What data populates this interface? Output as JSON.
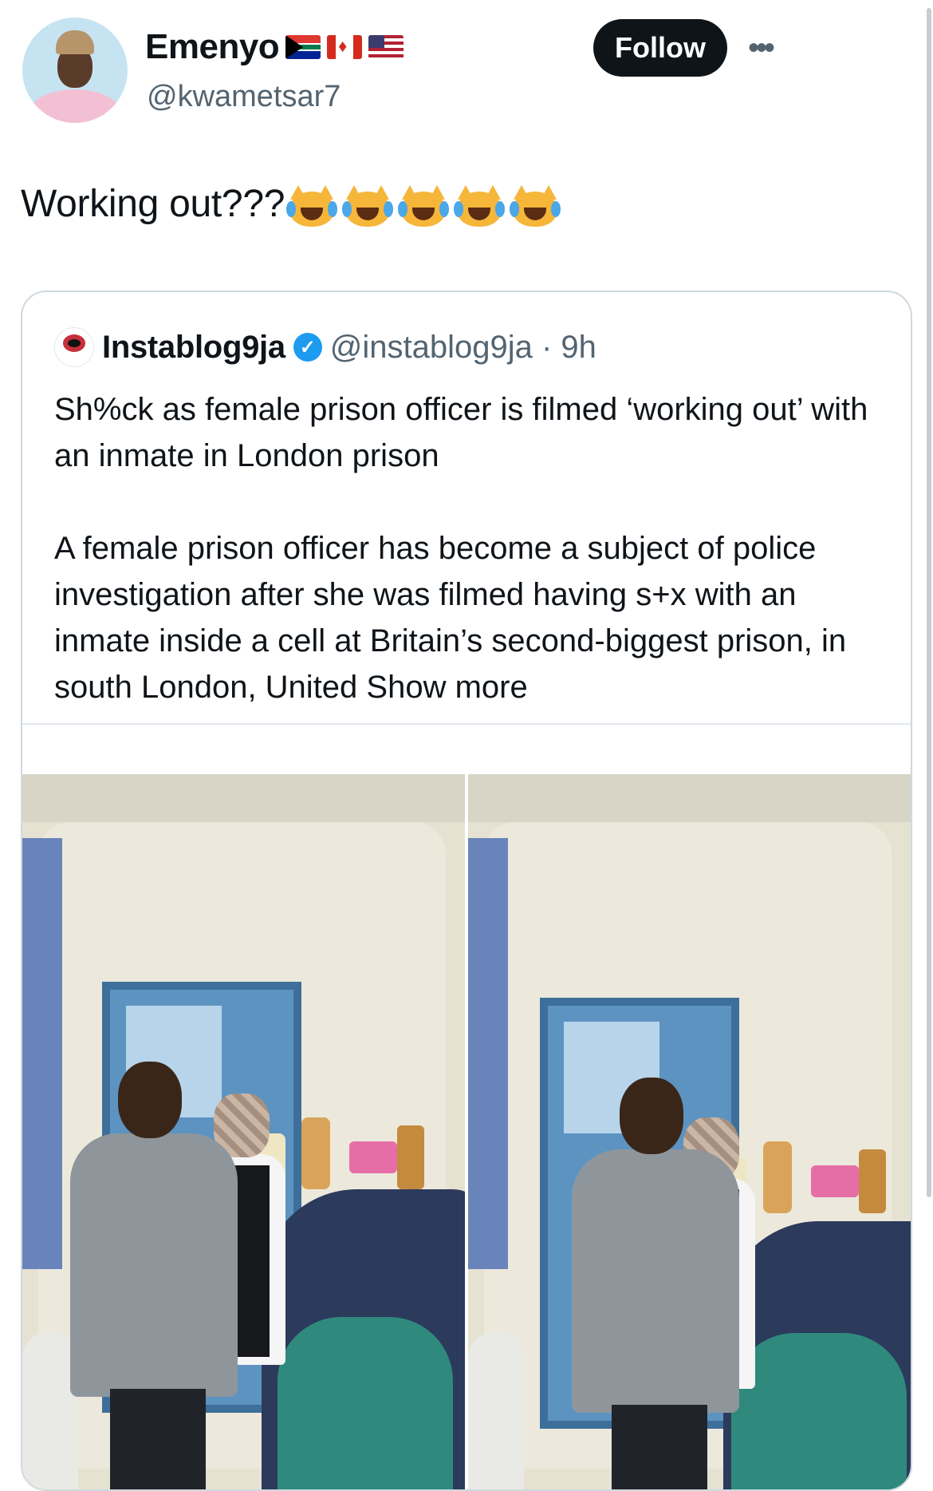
{
  "tweet": {
    "author_name": "Emenyo",
    "author_flags": [
      "flag-south-africa-icon",
      "flag-canada-icon",
      "flag-usa-icon"
    ],
    "author_handle": "@kwametsar7",
    "follow_label": "Follow",
    "more_label": "•••",
    "text": "Working out???",
    "emoji": [
      "cat-with-tears-of-joy",
      "cat-with-tears-of-joy",
      "cat-with-tears-of-joy",
      "cat-with-tears-of-joy",
      "cat-with-tears-of-joy"
    ]
  },
  "quote": {
    "author_name": "Instablog9ja",
    "verified_icon": "✓",
    "handle_time": "@instablog9ja · 9h",
    "headline": "Sh%ck as female prison officer is filmed ‘working out’ with an inmate in London prison",
    "body": "A female prison officer has become a subject of police investigation after she was filmed having s+x with an inmate inside a cell at Britain’s second-biggest prison, in south London, United",
    "show_more": "Show more"
  },
  "colors": {
    "text_primary": "#0f1419",
    "text_secondary": "#536471",
    "border": "#cfd9de",
    "verified": "#1d9bf0",
    "follow_bg": "#0f1419"
  }
}
